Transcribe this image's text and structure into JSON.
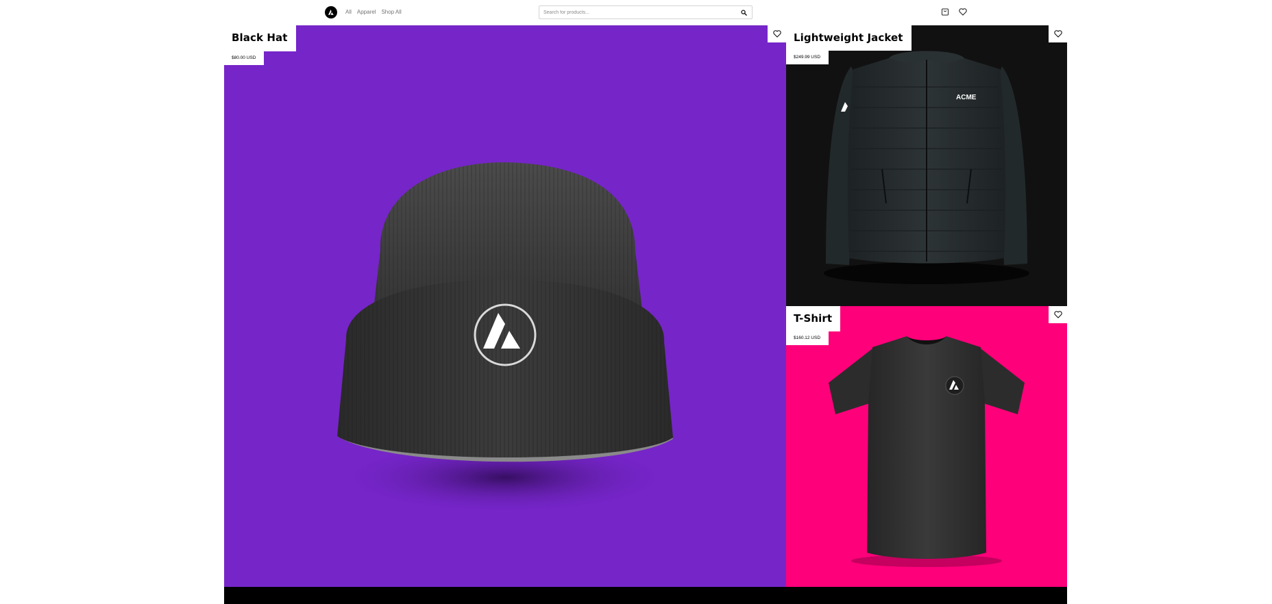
{
  "header": {
    "logo_icon": "acme-logo-icon",
    "nav": [
      {
        "label": "All"
      },
      {
        "label": "Apparel"
      },
      {
        "label": "Shop All"
      }
    ],
    "search": {
      "placeholder": "Search for products...",
      "value": "",
      "icon": "search-icon"
    },
    "icons": [
      "cart-icon",
      "heart-icon"
    ]
  },
  "products": [
    {
      "title": "Black Hat",
      "price": "$80.00 USD",
      "background": "#7625c9",
      "favorite_icon": "heart-icon"
    },
    {
      "title": "Lightweight Jacket",
      "price": "$249.99 USD",
      "background": "#111111",
      "favorite_icon": "heart-icon",
      "brand_text": "ACME"
    },
    {
      "title": "T-Shirt",
      "price": "$160.12 USD",
      "background": "#fe007a",
      "favorite_icon": "heart-icon"
    }
  ],
  "colors": {
    "accent_purple": "#7625c9",
    "accent_pink": "#fe007a",
    "dark": "#111111"
  }
}
